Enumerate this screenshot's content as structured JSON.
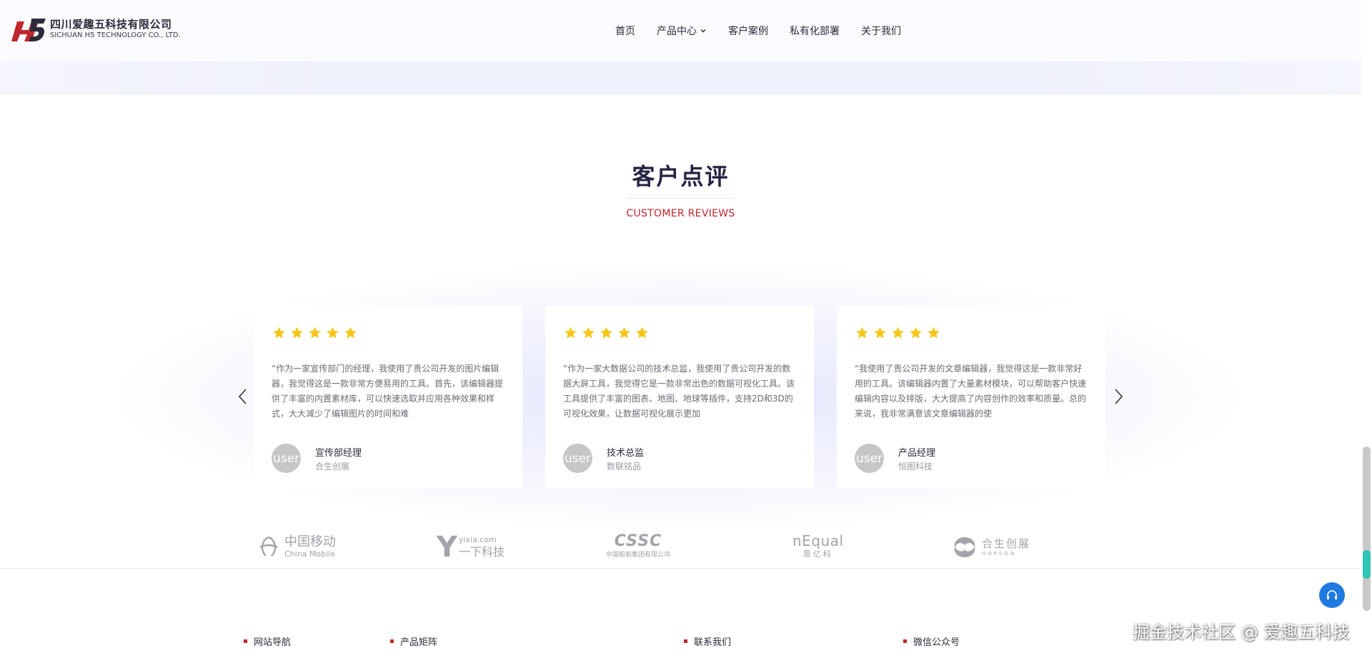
{
  "header": {
    "company_cn": "四川爱趣五科技有限公司",
    "company_en": "SICHUAN H5 TECHNOLOGY CO., LTD.",
    "nav": [
      {
        "label": "首页"
      },
      {
        "label": "产品中心",
        "has_dropdown": true
      },
      {
        "label": "客户案例"
      },
      {
        "label": "私有化部署"
      },
      {
        "label": "关于我们"
      }
    ]
  },
  "reviews_section": {
    "title": "客户点评",
    "subtitle": "CUSTOMER REVIEWS",
    "cards": [
      {
        "rating": 5,
        "text": "“作为一家宣传部门的经理，我使用了贵公司开发的图片编辑器，我觉得这是一款非常方便易用的工具。首先，该编辑器提供了丰富的内置素材库，可以快速选取并应用各种效果和样式，大大减少了编辑图片的时间和难",
        "avatar_text": "user",
        "role": "宣传部经理",
        "company": "合生创展"
      },
      {
        "rating": 5,
        "text": "“作为一家大数据公司的技术总监，我使用了贵公司开发的数据大屏工具，我觉得它是一款非常出色的数据可视化工具。该工具提供了丰富的图表、地图、地球等插件，支持2D和3D的可视化效果，让数据可视化展示更加",
        "avatar_text": "user",
        "role": "技术总监",
        "company": "数联铭品"
      },
      {
        "rating": 5,
        "text": "“我使用了贵公司开发的文章编辑器，我觉得这是一款非常好用的工具。该编辑器内置了大量素材模块，可以帮助客户快速编辑内容以及排版，大大提高了内容创作的效率和质量。总的来说，我非常满意该文章编辑器的使",
        "avatar_text": "user",
        "role": "产品经理",
        "company": "恒图科技"
      }
    ]
  },
  "partners": [
    {
      "name": "中国移动",
      "sub": "China Mobile"
    },
    {
      "name": "yixia.com",
      "sub": "一下科技"
    },
    {
      "name": "CSSC",
      "sub": "中国船舶集团有限公司"
    },
    {
      "name": "nEqual",
      "sub": "恩亿科"
    },
    {
      "name": "合生创展",
      "sub": "HOPSON"
    }
  ],
  "footer": {
    "columns": [
      "网站导航",
      "产品矩阵",
      "联系我们",
      "微信公众号"
    ]
  },
  "watermark": "掘金技术社区 @ 爱趣五科技",
  "colors": {
    "accent_red": "#c1272d",
    "star": "#f5c518",
    "help_button": "#1f7ae0",
    "title": "#232342"
  }
}
